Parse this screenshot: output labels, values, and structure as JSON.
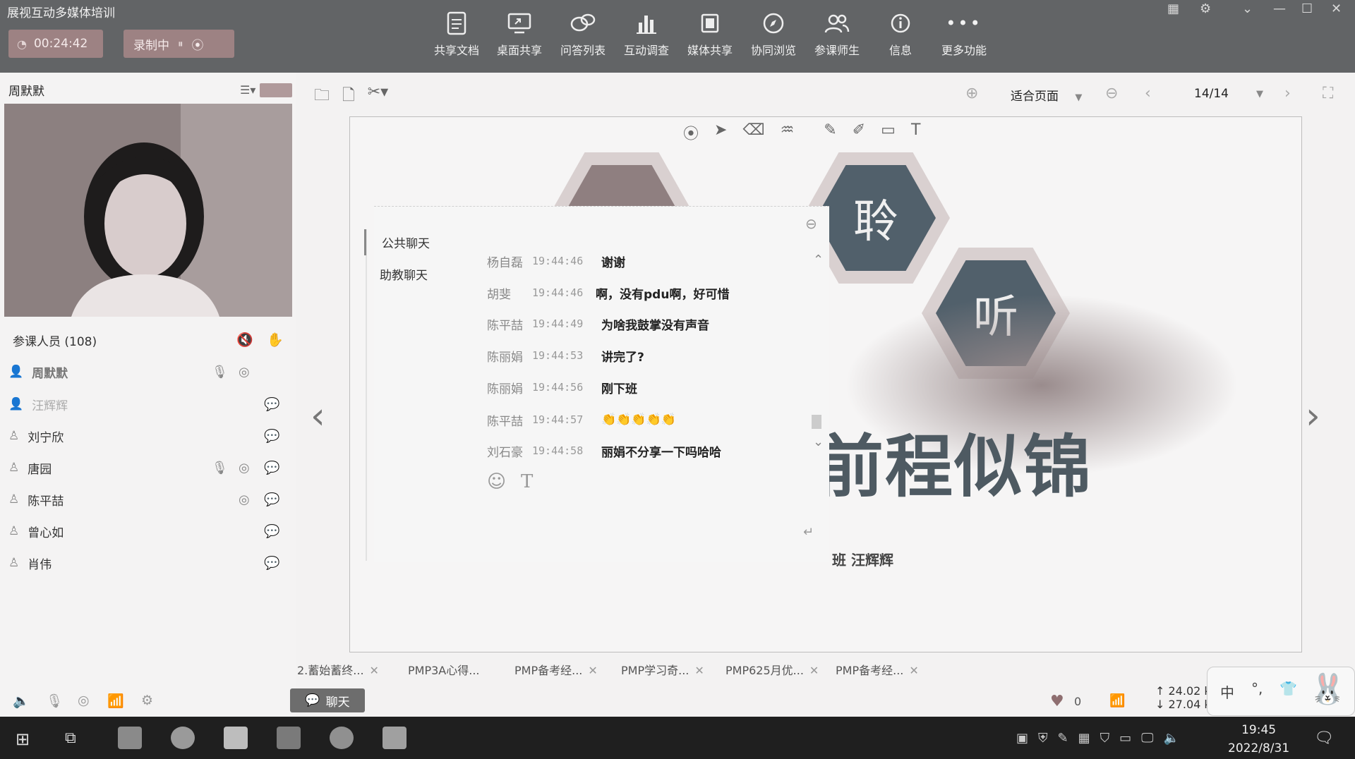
{
  "app": {
    "title": "展视互动多媒体培训"
  },
  "header": {
    "timer": "00:24:42",
    "rec_label": "录制中"
  },
  "toolbar": {
    "items": [
      {
        "label": "共享文档",
        "icon": "share-doc-icon"
      },
      {
        "label": "桌面共享",
        "icon": "desktop-share-icon"
      },
      {
        "label": "问答列表",
        "icon": "qa-list-icon"
      },
      {
        "label": "互动调查",
        "icon": "survey-icon"
      },
      {
        "label": "媒体共享",
        "icon": "media-share-icon"
      },
      {
        "label": "协同浏览",
        "icon": "cobrowse-icon"
      },
      {
        "label": "参课师生",
        "icon": "attendees-icon"
      },
      {
        "label": "信息",
        "icon": "info-icon"
      },
      {
        "label": "更多功能",
        "icon": "more-icon"
      }
    ]
  },
  "sidebar": {
    "host_name": "周默默",
    "participants_label": "参课人员 (108)",
    "participants": [
      {
        "name": "周默默"
      },
      {
        "name": "汪辉辉"
      },
      {
        "name": "刘宁欣"
      },
      {
        "name": "唐园"
      },
      {
        "name": "陈平喆"
      },
      {
        "name": "曾心如"
      },
      {
        "name": "肖伟"
      }
    ]
  },
  "doc_toolbar": {
    "zoom": "适合页面",
    "page": "14/14"
  },
  "slide": {
    "hex1": "聆",
    "hex2": "听",
    "big_title": "前程似锦",
    "subtitle": "班 汪辉辉"
  },
  "chat": {
    "tabs": [
      "公共聊天",
      "助教聊天"
    ],
    "messages": [
      {
        "who": "杨自磊",
        "time": "19:44:46",
        "text": "谢谢"
      },
      {
        "who": "胡斐",
        "time": "19:44:46",
        "text": "啊，没有pdu啊，好可惜"
      },
      {
        "who": "陈平喆",
        "time": "19:44:49",
        "text": "为啥我鼓掌没有声音"
      },
      {
        "who": "陈丽娟",
        "time": "19:44:53",
        "text": "讲完了?"
      },
      {
        "who": "陈丽娟",
        "time": "19:44:56",
        "text": "刚下班"
      },
      {
        "who": "陈平喆",
        "time": "19:44:57",
        "text": "👏👏👏👏👏"
      },
      {
        "who": "刘石豪",
        "time": "19:44:58",
        "text": "丽娟不分享一下吗哈哈"
      }
    ]
  },
  "doc_tabs": [
    "2.蓄始蓄终...",
    "PMP3A心得...",
    "PMP备考经...",
    "PMP学习奇...",
    "PMP625月优...",
    "PMP备考经..."
  ],
  "bottom": {
    "chat_button": "聊天",
    "likes": "0",
    "up_rate": "24.02 kb",
    "down_rate": "27.04 kb"
  },
  "ime": {
    "mode": "中"
  },
  "taskbar": {
    "time": "19:45",
    "date": "2022/8/31"
  }
}
